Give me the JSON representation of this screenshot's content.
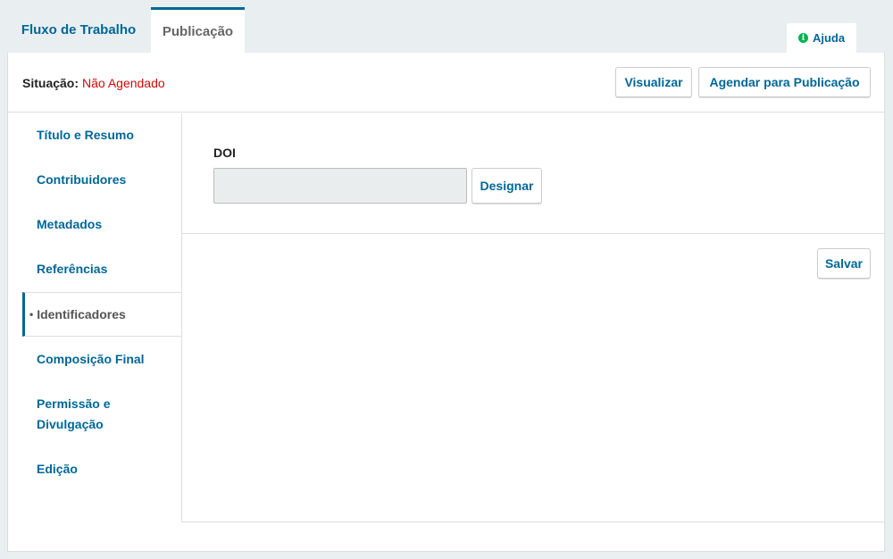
{
  "tabs": [
    {
      "label": "Fluxo de Trabalho"
    },
    {
      "label": "Publicação"
    }
  ],
  "help": {
    "label": "Ajuda",
    "icon": "info-icon",
    "icon_glyph": "i"
  },
  "status": {
    "label": "Situação:",
    "value": "Não Agendado"
  },
  "actions": {
    "preview": "Visualizar",
    "schedule": "Agendar para Publicação"
  },
  "sidebar": {
    "items": [
      {
        "label": "Título e Resumo"
      },
      {
        "label": "Contribuidores"
      },
      {
        "label": "Metadados"
      },
      {
        "label": "Referências"
      },
      {
        "label": "Identificadores",
        "active": true
      },
      {
        "label": "Composição Final"
      },
      {
        "label": "Permissão e Divulgação"
      },
      {
        "label": "Edição"
      }
    ]
  },
  "doi": {
    "label": "DOI",
    "value": "",
    "assign_label": "Designar"
  },
  "form": {
    "save_label": "Salvar"
  },
  "colors": {
    "accent": "#006798",
    "status_unscheduled": "#d00a0a",
    "help_icon": "#00b24e"
  }
}
